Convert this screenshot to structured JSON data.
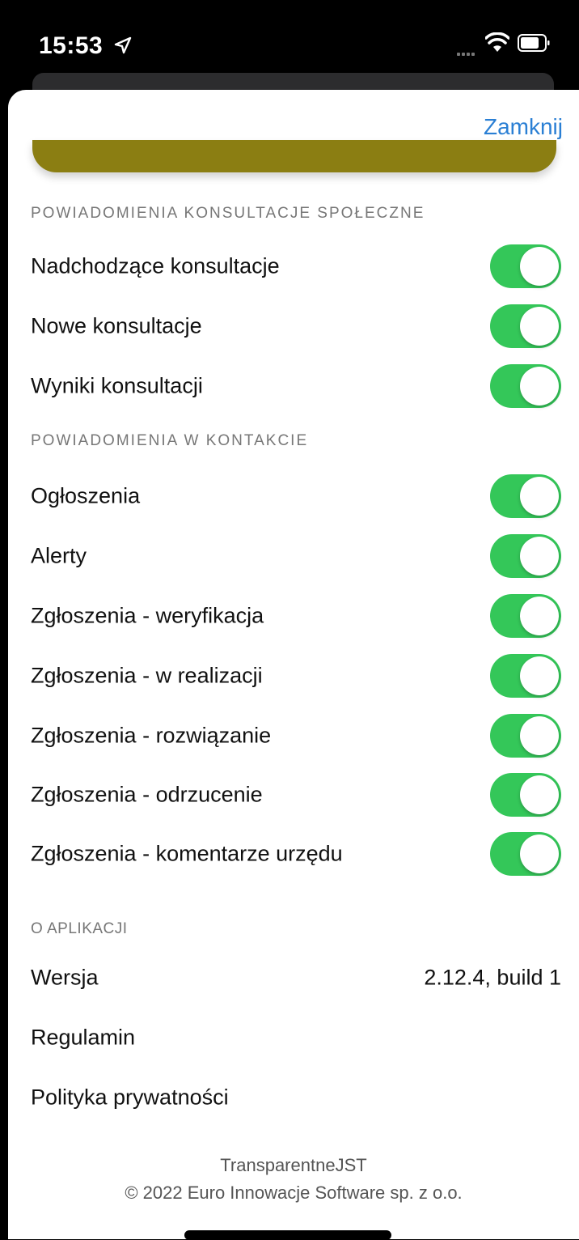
{
  "status_bar": {
    "time": "15:53"
  },
  "header": {
    "close_label": "Zamknij"
  },
  "sections": {
    "consultations": {
      "title": "POWIADOMIENIA KONSULTACJE SPOŁECZNE",
      "items": [
        {
          "label": "Nadchodzące konsultacje",
          "enabled": true
        },
        {
          "label": "Nowe konsultacje",
          "enabled": true
        },
        {
          "label": "Wyniki konsultacji",
          "enabled": true
        }
      ]
    },
    "contact": {
      "title": "POWIADOMIENIA W KONTAKCIE",
      "items": [
        {
          "label": "Ogłoszenia",
          "enabled": true
        },
        {
          "label": "Alerty",
          "enabled": true
        },
        {
          "label": "Zgłoszenia - weryfikacja",
          "enabled": true
        },
        {
          "label": "Zgłoszenia - w realizacji",
          "enabled": true
        },
        {
          "label": "Zgłoszenia - rozwiązanie",
          "enabled": true
        },
        {
          "label": "Zgłoszenia - odrzucenie",
          "enabled": true
        },
        {
          "label": "Zgłoszenia - komentarze urzędu",
          "enabled": true
        }
      ]
    },
    "about": {
      "title": "O APLIKACJI",
      "version_label": "Wersja",
      "version_value": "2.12.4, build 1",
      "terms_label": "Regulamin",
      "privacy_label": "Polityka prywatności"
    }
  },
  "footer": {
    "app_name": "TransparentneJST",
    "copyright": "© 2022 Euro Innowacje Software sp. z o.o."
  },
  "colors": {
    "accent": "#2a7fd4",
    "toggle_on": "#34c759",
    "card_peek": "#8b7e12"
  }
}
